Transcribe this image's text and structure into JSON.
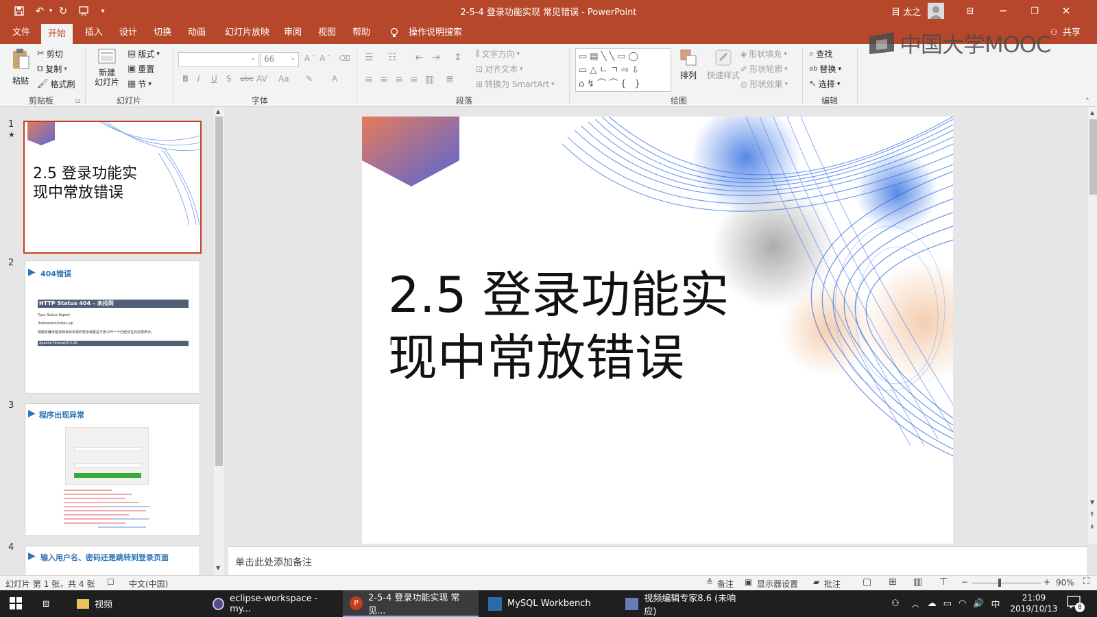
{
  "window": {
    "title": "2-5-4 登录功能实现  常见错误  -  PowerPoint",
    "user": "目 太之"
  },
  "menu": {
    "items": [
      "文件",
      "开始",
      "插入",
      "设计",
      "切换",
      "动画",
      "幻灯片放映",
      "审阅",
      "视图",
      "帮助"
    ],
    "search": "操作说明搜索",
    "share": "共享"
  },
  "ribbon": {
    "clipboard": {
      "paste": "粘贴",
      "cut": "剪切",
      "copy": "复制",
      "format_painter": "格式刷",
      "label": "剪贴板"
    },
    "slides": {
      "new_slide": "新建\n幻灯片",
      "layout": "版式",
      "reset": "重置",
      "section": "节",
      "label": "幻灯片"
    },
    "font": {
      "size": "66",
      "bold": "B",
      "italic": "I",
      "underline": "U",
      "shadow": "S",
      "strike": "abc",
      "spacing": "AV",
      "case": "Aa",
      "color": "A",
      "label": "字体"
    },
    "paragraph": {
      "text_direction": "文字方向",
      "align_text": "对齐文本",
      "smartart": "转换为 SmartArt",
      "label": "段落"
    },
    "drawing": {
      "arrange": "排列",
      "quick_styles": "快速样式",
      "fill": "形状填充",
      "outline": "形状轮廓",
      "effects": "形状效果",
      "label": "绘图"
    },
    "editing": {
      "find": "查找",
      "replace": "替换",
      "select": "选择",
      "label": "编辑"
    }
  },
  "watermark": "中国大学MOOC",
  "thumbnails": [
    {
      "num": "1",
      "marker": "★",
      "title": "2.5 登录功能实现中常放错误"
    },
    {
      "num": "2",
      "heading": "404错误",
      "http_title": "HTTP Status 404 – 未找到",
      "lines": [
        "Type Status Report",
        "/helloworld/notes.jsp",
        "源服务器未能找到目标资源的表示或者是不愿公开一个已经存在的资源表示。"
      ],
      "footer": "Apache Tomcat/8.0.26"
    },
    {
      "num": "3",
      "heading": "程序出现异常"
    },
    {
      "num": "4",
      "heading": "输入用户名、密码还是跳转到登录页面"
    }
  ],
  "slide": {
    "title": "2.5 登录功能实现中常放错误"
  },
  "notes": {
    "placeholder": "单击此处添加备注"
  },
  "status": {
    "slide_info": "幻灯片 第 1 张，共 4 张",
    "language": "中文(中国)",
    "notes": "备注",
    "display": "显示器设置",
    "comments": "批注",
    "zoom": "90%"
  },
  "taskbar": {
    "items": [
      "视频",
      "eclipse-workspace - my...",
      "2-5-4 登录功能实现  常见...",
      "MySQL Workbench",
      "视频编辑专家8.6 (未响应)"
    ],
    "time": "21:09",
    "date": "2019/10/13",
    "ime": "中",
    "notification_count": "8"
  },
  "colors": {
    "accent": "#b7472a",
    "selected": "#c43e1c",
    "heading_blue": "#2e75b6",
    "taskbar": "#1f1f1f"
  }
}
